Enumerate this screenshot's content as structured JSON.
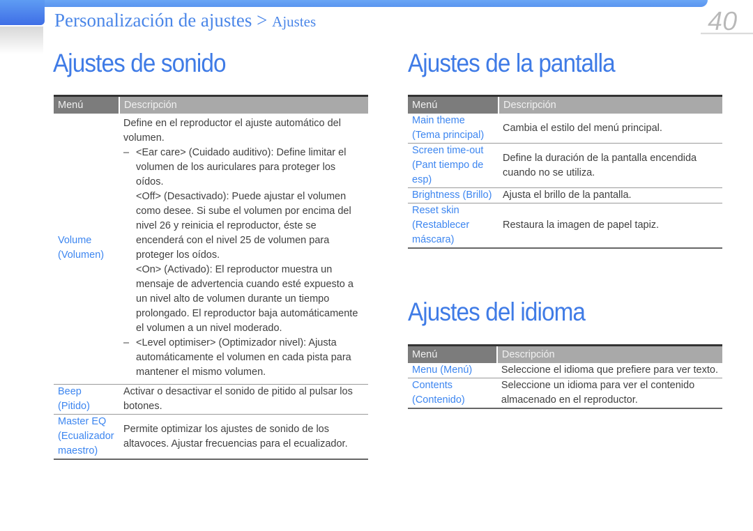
{
  "header": {
    "breadcrumb_main": "Personalización de ajustes",
    "breadcrumb_sep": ">",
    "breadcrumb_sub": "Ajustes",
    "page_number": "40"
  },
  "colors": {
    "accent": "#3f7be6",
    "menu_link": "#3d86f0",
    "header_dark": "#7c7c7c",
    "header_light": "#a9a9a9"
  },
  "sound": {
    "title": "Ajustes de sonido",
    "col_menu": "Menú",
    "col_desc": "Descripción",
    "volume": {
      "menu_1": "Volume",
      "menu_2": "(Volumen)",
      "intro": "Define en el reproductor el ajuste automático del volumen.",
      "dash1": "–",
      "earcare": "<Ear care> (Cuidado auditivo): Define limitar el volumen de los auriculares para proteger los oídos.",
      "off": "<Off> (Desactivado): Puede ajustar el volumen como desee. Si sube el volumen por encima del nivel 26 y reinicia el reproductor, éste se encenderá con el nivel 25 de volumen para proteger los oídos.",
      "on": "<On> (Activado): El reproductor muestra un mensaje de advertencia cuando esté expuesto a un nivel alto de volumen durante un tiempo prolongado. El reproductor baja automáticamente el volumen a un nivel moderado.",
      "dash2": "–",
      "level": "<Level optimiser> (Optimizador nivel): Ajusta automáticamente el volumen en cada pista para mantener el mismo volumen."
    },
    "rows": [
      {
        "menu": "Beep (Pitido)",
        "desc": "Activar o desactivar el sonido de pitido al pulsar los botones."
      },
      {
        "menu": "Master EQ (Ecualizador maestro)",
        "desc": "Permite optimizar los ajustes de sonido de los altavoces. Ajustar frecuencias para el ecualizador."
      }
    ]
  },
  "display": {
    "title": "Ajustes de la pantalla",
    "col_menu": "Menú",
    "col_desc": "Descripción",
    "rows": [
      {
        "menu": "Main theme (Tema principal)",
        "desc": "Cambia el estilo del menú principal."
      },
      {
        "menu": "Screen time-out (Pant tiempo de esp)",
        "desc": "Define la duración de la pantalla encendida cuando no se utiliza."
      },
      {
        "menu": "Brightness (Brillo)",
        "desc": "Ajusta el brillo de la pantalla."
      },
      {
        "menu": "Reset skin (Restablecer máscara)",
        "desc": "Restaura la imagen de papel tapiz."
      }
    ]
  },
  "language": {
    "title": "Ajustes del idioma",
    "col_menu": "Menú",
    "col_desc": "Descripción",
    "rows": [
      {
        "menu": "Menu (Menú)",
        "desc": "Seleccione el idioma que prefiere para ver texto."
      },
      {
        "menu": "Contents (Contenido)",
        "desc": "Seleccione un idioma para ver el contenido almacenado en el reproductor."
      }
    ]
  }
}
